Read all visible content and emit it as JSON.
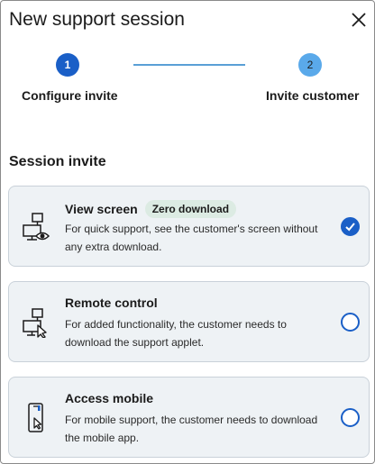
{
  "dialog": {
    "title": "New support session",
    "close_icon": "close-icon"
  },
  "stepper": {
    "steps": [
      {
        "number": "1",
        "label": "Configure invite",
        "active": true
      },
      {
        "number": "2",
        "label": "Invite customer",
        "active": false
      }
    ]
  },
  "section": {
    "title": "Session invite"
  },
  "options": [
    {
      "title": "View screen",
      "badge": "Zero download",
      "description": "For quick support, see the customer's screen without any extra download.",
      "icon": "view-screen-icon",
      "selected": true
    },
    {
      "title": "Remote control",
      "description": "For added functionality, the customer needs to download the support applet.",
      "icon": "remote-control-icon",
      "selected": false
    },
    {
      "title": "Access mobile",
      "description": "For mobile support, the customer needs to download the mobile app.",
      "icon": "mobile-icon",
      "selected": false
    }
  ],
  "colors": {
    "accent": "#1a5fc7",
    "step_inactive": "#5aa9ea",
    "card_bg": "#eef2f5",
    "badge_bg": "#dcebe3"
  }
}
